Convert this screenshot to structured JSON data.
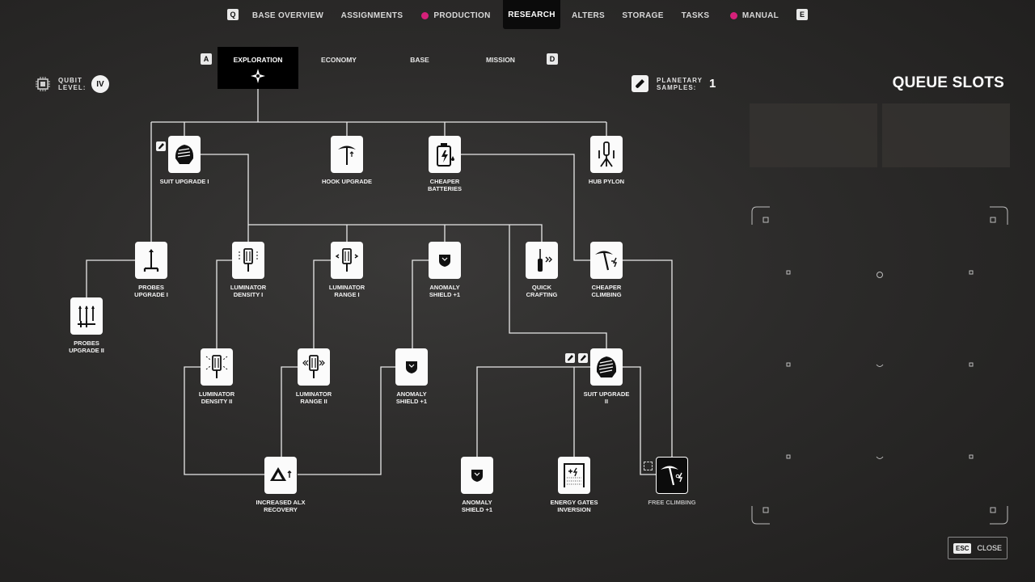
{
  "nav": {
    "key_left": "Q",
    "key_right": "E",
    "items": [
      {
        "label": "BASE OVERVIEW"
      },
      {
        "label": "ASSIGNMENTS"
      },
      {
        "label": "PRODUCTION"
      },
      {
        "label": "RESEARCH"
      },
      {
        "label": "ALTERS"
      },
      {
        "label": "STORAGE"
      },
      {
        "label": "TASKS"
      },
      {
        "label": "MANUAL"
      }
    ]
  },
  "subtabs": {
    "key_left": "A",
    "key_right": "D",
    "items": [
      {
        "label": "EXPLORATION"
      },
      {
        "label": "ECONOMY"
      },
      {
        "label": "BASE"
      },
      {
        "label": "MISSION"
      }
    ]
  },
  "qubit": {
    "label_line1": "QUBIT",
    "label_line2": "LEVEL:",
    "value": "IV"
  },
  "samples": {
    "label_line1": "PLANETARY",
    "label_line2": "SAMPLES:",
    "value": "1"
  },
  "queue": {
    "title": "QUEUE SLOTS"
  },
  "close": {
    "key": "ESC",
    "label": "CLOSE"
  },
  "colors": {
    "accent": "#d6207a",
    "panel": "#0b0b0b",
    "tile": "#fbfbfb"
  },
  "nodes": [
    {
      "id": "suit1",
      "line1": "SUIT UPGRADE I",
      "line2": "",
      "icon": "suit-icon"
    },
    {
      "id": "hook",
      "line1": "HOOK UPGRADE",
      "line2": "",
      "icon": "pickaxe-icon"
    },
    {
      "id": "batt",
      "line1": "CHEAPER",
      "line2": "BATTERIES",
      "icon": "battery-icon"
    },
    {
      "id": "pylon",
      "line1": "HUB PYLON",
      "line2": "",
      "icon": "pylon-icon"
    },
    {
      "id": "probes1",
      "line1": "PROBES",
      "line2": "UPGRADE I",
      "icon": "probe-icon"
    },
    {
      "id": "lumd1",
      "line1": "LUMINATOR",
      "line2": "DENSITY I",
      "icon": "luminator-icon"
    },
    {
      "id": "lumr1",
      "line1": "LUMINATOR",
      "line2": "RANGE I",
      "icon": "luminator-icon"
    },
    {
      "id": "anom1",
      "line1": "ANOMALY",
      "line2": "SHIELD +1",
      "icon": "shield-icon"
    },
    {
      "id": "quick",
      "line1": "QUICK",
      "line2": "CRAFTING",
      "icon": "screwdriver-icon"
    },
    {
      "id": "climb",
      "line1": "CHEAPER",
      "line2": "CLIMBING",
      "icon": "pickaxe-icon"
    },
    {
      "id": "probes2",
      "line1": "PROBES",
      "line2": "UPGRADE II",
      "icon": "probes-icon"
    },
    {
      "id": "lumd2",
      "line1": "LUMINATOR",
      "line2": "DENSITY II",
      "icon": "luminator-icon"
    },
    {
      "id": "lumr2",
      "line1": "LUMINATOR",
      "line2": "RANGE II",
      "icon": "luminator-icon"
    },
    {
      "id": "anom2",
      "line1": "ANOMALY",
      "line2": "SHIELD +1",
      "icon": "shield-icon"
    },
    {
      "id": "suit2",
      "line1": "SUIT UPGRADE",
      "line2": "II",
      "icon": "suit-icon"
    },
    {
      "id": "alx",
      "line1": "INCREASED ALX",
      "line2": "RECOVERY",
      "icon": "alx-icon"
    },
    {
      "id": "anom3",
      "line1": "ANOMALY",
      "line2": "SHIELD +1",
      "icon": "shield-icon"
    },
    {
      "id": "gates",
      "line1": "ENERGY GATES",
      "line2": "INVERSION",
      "icon": "gate-icon"
    },
    {
      "id": "free",
      "line1": "FREE CLIMBING",
      "line2": "",
      "icon": "pickaxe-icon"
    }
  ]
}
